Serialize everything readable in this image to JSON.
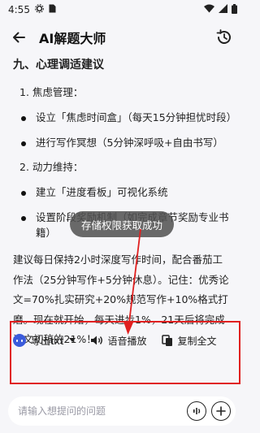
{
  "status_bar": {
    "time": "4:55"
  },
  "header": {
    "title": "AI解题大师"
  },
  "content": {
    "section_title": "九、心理调适建议",
    "items": [
      {
        "type": "num",
        "text": "1. 焦虑管理："
      },
      {
        "type": "bullet",
        "text": "设立「焦虑时间盒」（每天15分钟担忧时段）"
      },
      {
        "type": "bullet",
        "text": "进行写作冥想（5分钟深呼吸+自由书写）"
      },
      {
        "type": "num",
        "text": "2. 动力维持："
      },
      {
        "type": "bullet",
        "text": "建立「进度看板」可视化系统"
      },
      {
        "type": "bullet",
        "text": "设置阶段奖励机制（如完成章节奖励专业书籍）"
      }
    ],
    "paragraph": "建议每日保持2小时深度写作时间，配合番茄工作法（25分钟写作+5分钟休息）。记住：优秀论文=70%扎实研究+20%规范写作+10%格式打磨。现在就开始，每天进步1%，21天后将完成论文初稿的21%！"
  },
  "toast": {
    "text": "存储权限获取成功"
  },
  "actions": {
    "export_label": "导出txt",
    "voice_label": "语音播放",
    "copy_label": "复制全文"
  },
  "input": {
    "placeholder": "请输入想提问的问题"
  },
  "colors": {
    "highlight": "#e02020",
    "accent": "#3b5bdb"
  }
}
